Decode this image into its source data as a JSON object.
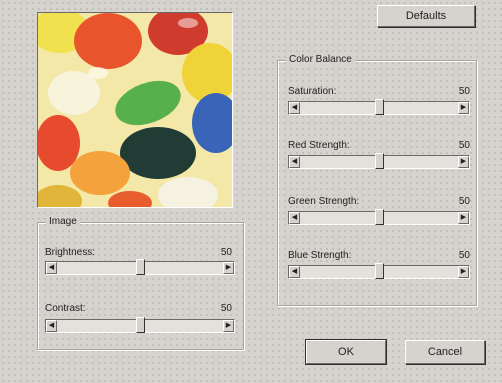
{
  "buttons": {
    "defaults": "Defaults",
    "ok": "OK",
    "cancel": "Cancel"
  },
  "image_group": {
    "legend": "Image",
    "brightness": {
      "label": "Brightness:",
      "value": "50",
      "level": 0.5
    },
    "contrast": {
      "label": "Contrast:",
      "value": "50",
      "level": 0.5
    }
  },
  "color_group": {
    "legend": "Color Balance",
    "saturation": {
      "label": "Saturation:",
      "value": "50",
      "level": 0.5
    },
    "red": {
      "label": "Red Strength:",
      "value": "50",
      "level": 0.5
    },
    "green": {
      "label": "Green Strength:",
      "value": "50",
      "level": 0.5
    },
    "blue": {
      "label": "Blue Strength:",
      "value": "50",
      "level": 0.5
    }
  },
  "icons": {
    "left": "left-arrow-icon",
    "right": "right-arrow-icon"
  }
}
